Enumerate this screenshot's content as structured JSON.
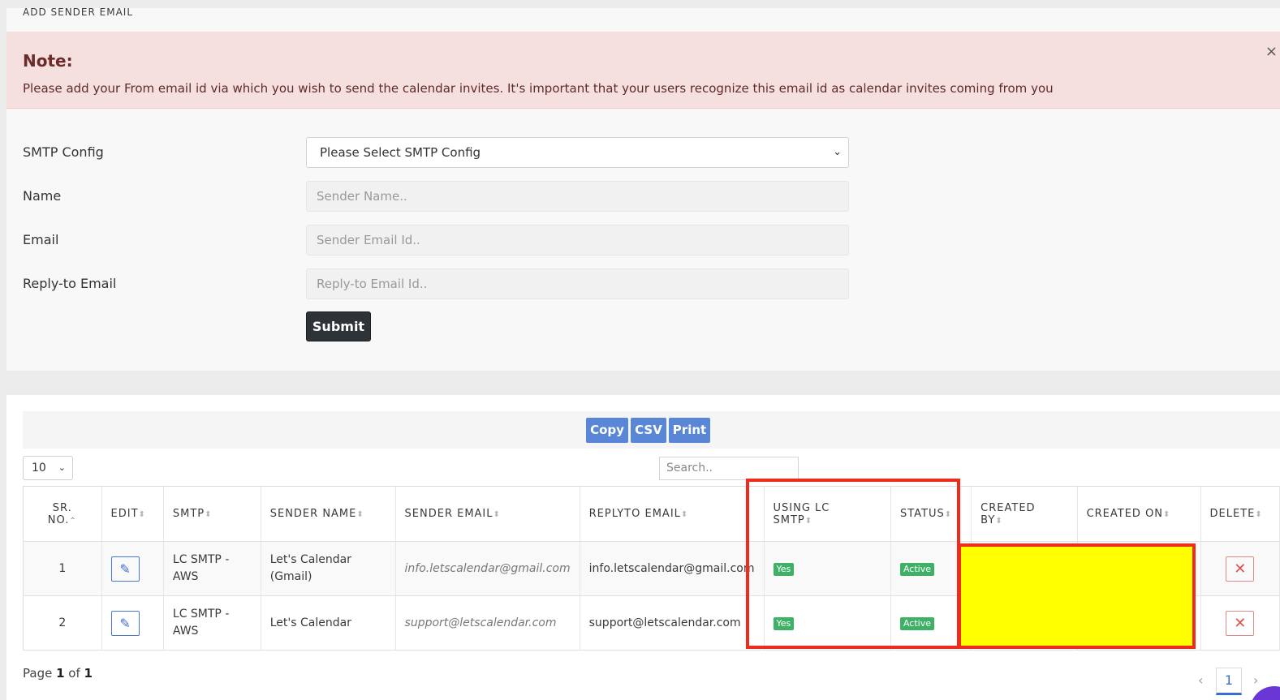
{
  "card_title": "ADD SENDER EMAIL",
  "alert": {
    "heading": "Note:",
    "message": "Please add your From email id via which you wish to send the calendar invites. It's important that your users recognize this email id as calendar invites coming from you",
    "close_label": "×"
  },
  "form": {
    "smtp_label": "SMTP Config",
    "smtp_selected": "Please Select SMTP Config",
    "name_label": "Name",
    "name_placeholder": "Sender Name..",
    "email_label": "Email",
    "email_placeholder": "Sender Email Id..",
    "reply_label": "Reply-to Email",
    "reply_placeholder": "Reply-to Email Id..",
    "submit_label": "Submit"
  },
  "toolbar": {
    "copy": "Copy",
    "csv": "CSV",
    "print": "Print"
  },
  "page_length": "10",
  "search_placeholder": "Search..",
  "table": {
    "headers": {
      "sr_no_1": "SR.",
      "sr_no_2": "NO.",
      "edit": "EDIT",
      "smtp": "SMTP",
      "sender_name": "SENDER NAME",
      "sender_email": "SENDER EMAIL",
      "replyto_email": "REPLYTO EMAIL",
      "using_lc_smtp_1": "USING LC",
      "using_lc_smtp_2": "SMTP",
      "status": "STATUS",
      "created_by_1": "CREATED",
      "created_by_2": "BY",
      "created_on": "CREATED ON",
      "delete": "DELETE"
    },
    "rows": [
      {
        "sr_no": "1",
        "smtp_1": "LC SMTP -",
        "smtp_2": "AWS",
        "sender_name_1": "Let's Calendar",
        "sender_name_2": "(Gmail)",
        "sender_email": "info.letscalendar@gmail.com",
        "replyto_email": "info.letscalendar@gmail.com",
        "using_lc_smtp": "Yes",
        "status": "Active"
      },
      {
        "sr_no": "2",
        "smtp_1": "LC SMTP -",
        "smtp_2": "AWS",
        "sender_name_1": "Let's Calendar",
        "sender_name_2": "",
        "sender_email": "support@letscalendar.com",
        "replyto_email": "support@letscalendar.com",
        "using_lc_smtp": "Yes",
        "status": "Active"
      }
    ]
  },
  "pagination": {
    "info_prefix": "Page ",
    "current": "1",
    "info_mid": " of ",
    "total": "1",
    "page_button": "1"
  },
  "colors": {
    "accent": "#5a86d6",
    "badge_green": "#3fb166",
    "highlight_red": "#ee2b1c",
    "highlight_yellow": "#ffff00"
  }
}
